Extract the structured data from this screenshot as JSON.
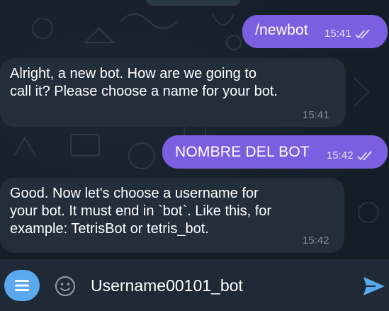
{
  "messages": [
    {
      "direction": "outgoing",
      "text": "/newbot",
      "time": "15:41",
      "status": "read"
    },
    {
      "direction": "incoming",
      "lines": [
        "Alright, a new bot. How are we going to",
        "call it? Please choose a name for your bot."
      ],
      "time": "15:41"
    },
    {
      "direction": "outgoing",
      "text": "NOMBRE DEL BOT",
      "time": "15:42",
      "status": "read"
    },
    {
      "direction": "incoming",
      "lines": [
        "Good. Now let's choose a username for",
        "your bot. It must end in `bot`. Like this, for",
        "example: TetrisBot or tetris_bot."
      ],
      "time": "15:42"
    }
  ],
  "composer": {
    "value": "Username00101_bot",
    "menu_icon": "menu-icon",
    "emoji_icon": "emoji-icon",
    "send_icon": "send-icon"
  },
  "colors": {
    "outgoing_bubble": "#7b5fe0",
    "incoming_bubble": "#222e3a",
    "background": "#17212b",
    "accent": "#5aa9ee"
  }
}
